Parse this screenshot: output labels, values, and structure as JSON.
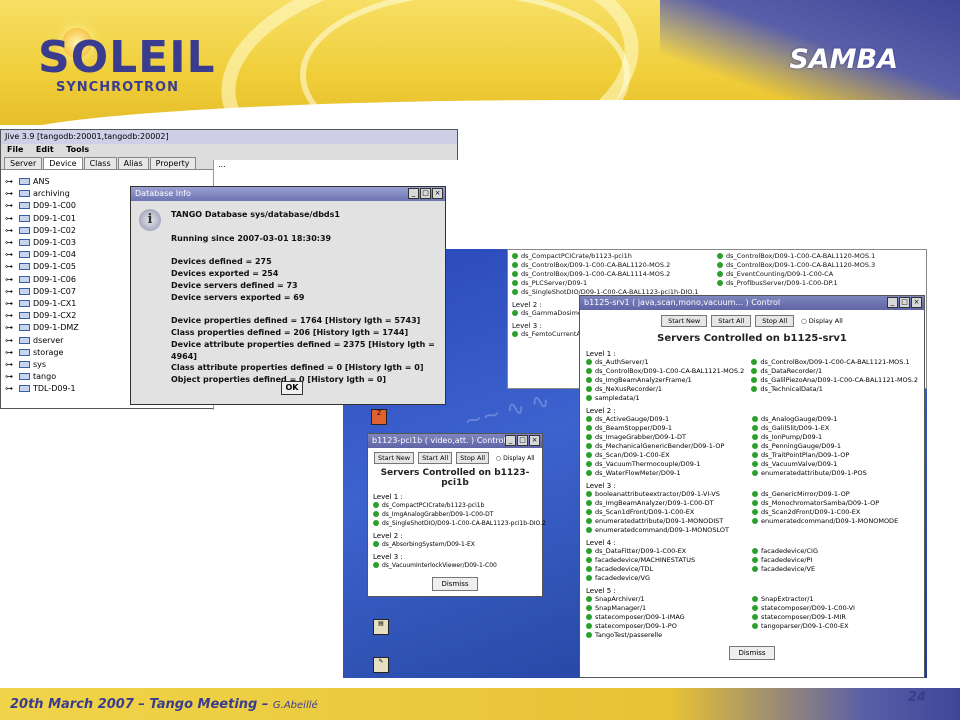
{
  "header": {
    "logo_text": "SOLEIL",
    "logo_sub": "SYNCHROTRON",
    "title": "SAMBA"
  },
  "footer": {
    "date_text": "20th March 2007 – Tango Meeting – ",
    "author": "G.Abeillé",
    "page": "24"
  },
  "jive": {
    "title": "Jive 3.9 [tangodb:20001,tangodb:20002]",
    "menu": [
      "File",
      "Edit",
      "Tools"
    ],
    "tabs": [
      "Server",
      "Device",
      "Class",
      "Alias",
      "Property"
    ],
    "selected_tab": "Device",
    "tree": [
      "ANS",
      "archiving",
      "D09-1-C00",
      "D09-1-C01",
      "D09-1-C02",
      "D09-1-C03",
      "D09-1-C04",
      "D09-1-C05",
      "D09-1-C06",
      "D09-1-C07",
      "D09-1-CX1",
      "D09-1-CX2",
      "D09-1-DMZ",
      "dserver",
      "storage",
      "sys",
      "tango",
      "TDL-D09-1"
    ],
    "right_label": "..."
  },
  "db_info": {
    "title": "Database Info",
    "lines": [
      "TANGO Database sys/database/dbds1",
      "",
      "Running since 2007-03-01 18:30:39",
      "",
      "Devices defined = 275",
      "Devices exported = 254",
      "Device servers defined = 73",
      "Device servers exported = 69",
      "",
      "Device properties defined = 1764 [History lgth = 5743]",
      "Class properties defined = 206 [History lgth = 1744]",
      "Device attribute properties defined = 2375 [History lgth = 4964]",
      "Class attribute properties defined = 0 [History lgth = 0]",
      "Object properties defined = 0 [History lgth = 0]"
    ],
    "ok": "OK"
  },
  "back_panel": {
    "col1": [
      "ds_CompactPCICrate/b1123-pci1h",
      "ds_ControlBox/D09-1-C00-CA-BAL1120-MOS.2",
      "ds_ControlBox/D09-1-C00-CA-BAL1114-MOS.2",
      "ds_PLCServer/D09-1",
      "ds_SingleShotDIO/D09-1-C00-CA-BAL1123-pci1h-DIO.1"
    ],
    "col2": [
      "ds_ControlBox/D09-1-C00-CA-BAL1120-MOS.1",
      "ds_ControlBox/D09-1-C00-CA-BAL1120-MOS.3",
      "ds_EventCounting/D09-1-C00-CA",
      "ds_ProfibusServer/D09-1-C00-DP.1"
    ],
    "level2": "Level 2 :",
    "level2_items": [
      "ds_GammaDosimeter/..."
    ],
    "level3": "Level 3 :",
    "level3_items": [
      "ds_FemtoCurrentAmpl..."
    ]
  },
  "srv1": {
    "title": "b1125-srv1 ( java,scan,mono,vacuum... ) Control",
    "buttons": [
      "Start New",
      "Start All",
      "Stop All"
    ],
    "display_all": "Display All",
    "heading": "Servers Controlled on b1125-srv1",
    "levels": [
      {
        "label": "Level 1 :",
        "a": [
          "ds_AuthServer/1",
          "ds_ControlBox/D09-1-C00-CA-BAL1121-MOS.2",
          "ds_ImgBeamAnalyzerFrame/1",
          "ds_NeXusRecorder/1",
          "sampledata/1"
        ],
        "b": [
          "ds_ControlBox/D09-1-C00-CA-BAL1121-MOS.1",
          "ds_DataRecorder/1",
          "ds_GalilPiezoAna/D09-1-C00-CA-BAL1121-MOS.2",
          "ds_TechnicalData/1"
        ]
      },
      {
        "label": "Level 2 :",
        "a": [
          "ds_ActiveGauge/D09-1",
          "ds_BeamStopper/D09-1",
          "ds_ImageGrabber/D09-1-DT",
          "ds_MechanicalGenericBender/D09-1-OP",
          "ds_Scan/D09-1-C00-EX",
          "ds_VacuumThermocouple/D09-1",
          "ds_WaterFlowMeter/D09-1"
        ],
        "b": [
          "ds_AnalogGauge/D09-1",
          "ds_GalilSlit/D09-1-EX",
          "ds_IonPump/D09-1",
          "ds_PenningGauge/D09-1",
          "ds_TraitPointPlan/D09-1-OP",
          "ds_VacuumValve/D09-1",
          "enumeratedattribute/D09-1-POS"
        ]
      },
      {
        "label": "Level 3 :",
        "a": [
          "booleanattributeextractor/D09-1-VI-VS",
          "ds_ImgBeamAnalyzer/D09-1-C00-DT",
          "ds_Scan1dFront/D09-1-C00-EX",
          "enumeratedattribute/D09-1-MONODIST",
          "enumeratedcommand/D09-1-MONOSLOT"
        ],
        "b": [
          "ds_GenericMirror/D09-1-OP",
          "ds_MonochromatorSamba/D09-1-OP",
          "ds_Scan2dFront/D09-1-C00-EX",
          "enumeratedcommand/D09-1-MONOMODE"
        ]
      },
      {
        "label": "Level 4 :",
        "a": [
          "ds_DataFitter/D09-1-C00-EX",
          "facadedevice/MACHINESTATUS",
          "facadedevice/TDL",
          "facadedevice/VG"
        ],
        "b": [
          "facadedevice/CIG",
          "facadedevice/PI",
          "facadedevice/VE"
        ]
      },
      {
        "label": "Level 5 :",
        "a": [
          "SnapArchiver/1",
          "SnapManager/1",
          "statecomposer/D09-1-IMAG",
          "statecomposer/D09-1-PO",
          "TangoTest/passerelle"
        ],
        "b": [
          "SnapExtractor/1",
          "statecomposer/D09-1-C00-VI",
          "statecomposer/D09-1-MIR",
          "tangoparser/D09-1-C00-EX"
        ]
      }
    ],
    "dismiss": "Dismiss"
  },
  "pci1b": {
    "title": "b1123-pci1b ( video,att. ) Control",
    "buttons": [
      "Start New",
      "Start All",
      "Stop All"
    ],
    "display_all": "Display All",
    "heading": "Servers Controlled on b1123-pci1b",
    "levels": [
      {
        "label": "Level 1 :",
        "items": [
          "ds_CompactPCICrate/b1123-pci1b",
          "ds_ImgAnalogGrabber/D09-1-C00-DT",
          "ds_SingleShotDIO/D09-1-C00-CA-BAL1123-pci1b-DIO.2"
        ]
      },
      {
        "label": "Level 2 :",
        "items": [
          "ds_AbsorbingSystem/D09-1-EX"
        ]
      },
      {
        "label": "Level 3 :",
        "items": [
          "ds_VacuumInterlockViewer/D09-1-C00"
        ]
      }
    ],
    "dismiss": "Dismiss"
  }
}
